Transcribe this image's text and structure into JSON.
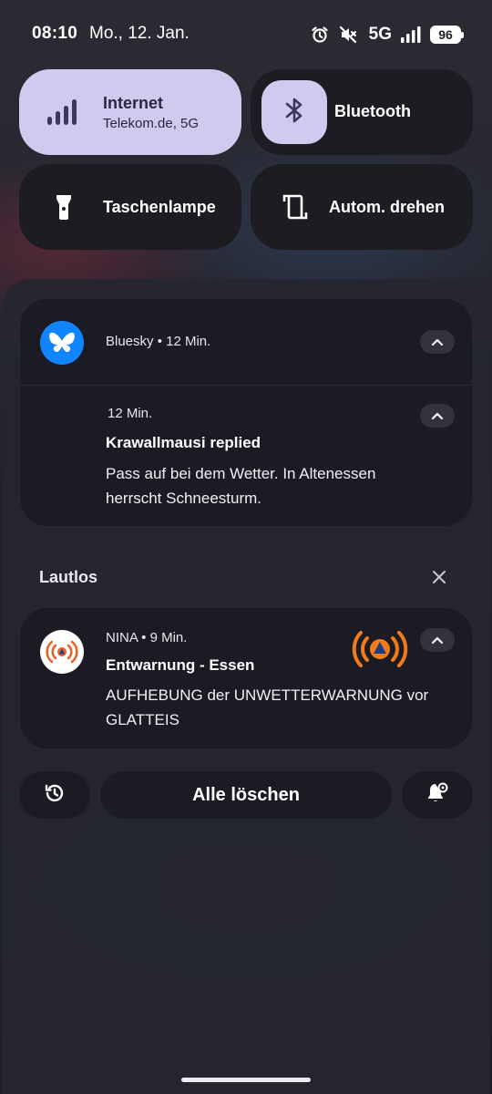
{
  "status_bar": {
    "time": "08:10",
    "date": "Mo., 12. Jan.",
    "network": "5G",
    "battery": "96",
    "icons": [
      "alarm-icon",
      "mute-icon",
      "signal-icon",
      "battery-icon"
    ]
  },
  "quick_tiles": [
    {
      "label": "Internet",
      "sub": "Telekom.de, 5G",
      "icon": "signal-bars-icon",
      "active": true
    },
    {
      "label": "Bluetooth",
      "icon": "bluetooth-icon",
      "active": true
    },
    {
      "label": "Taschenlampe",
      "icon": "flashlight-icon",
      "active": false
    },
    {
      "label": "Autom. drehen",
      "icon": "auto-rotate-icon",
      "active": false
    }
  ],
  "notifications": {
    "bluesky": {
      "app": "Bluesky",
      "time": "12 Min.",
      "header": "Bluesky • 12 Min.",
      "message_time": "12 Min.",
      "title": "Krawallmausi replied",
      "body": "Pass auf bei dem Wetter. In Altenessen herrscht Schneesturm."
    },
    "silent_section": {
      "label": "Lautlos"
    },
    "nina": {
      "header": "NINA • 9 Min.",
      "title": "Entwarnung - Essen",
      "body": "AUFHEBUNG der UNWETTERWARNUNG vor GLATTEIS"
    }
  },
  "footer": {
    "clear_all": "Alle löschen"
  },
  "colors": {
    "tile_active": "#cfcaee",
    "tile_inactive": "#1c1c22",
    "bluesky_blue": "#1185fe",
    "nina_orange": "#f07b1c"
  }
}
